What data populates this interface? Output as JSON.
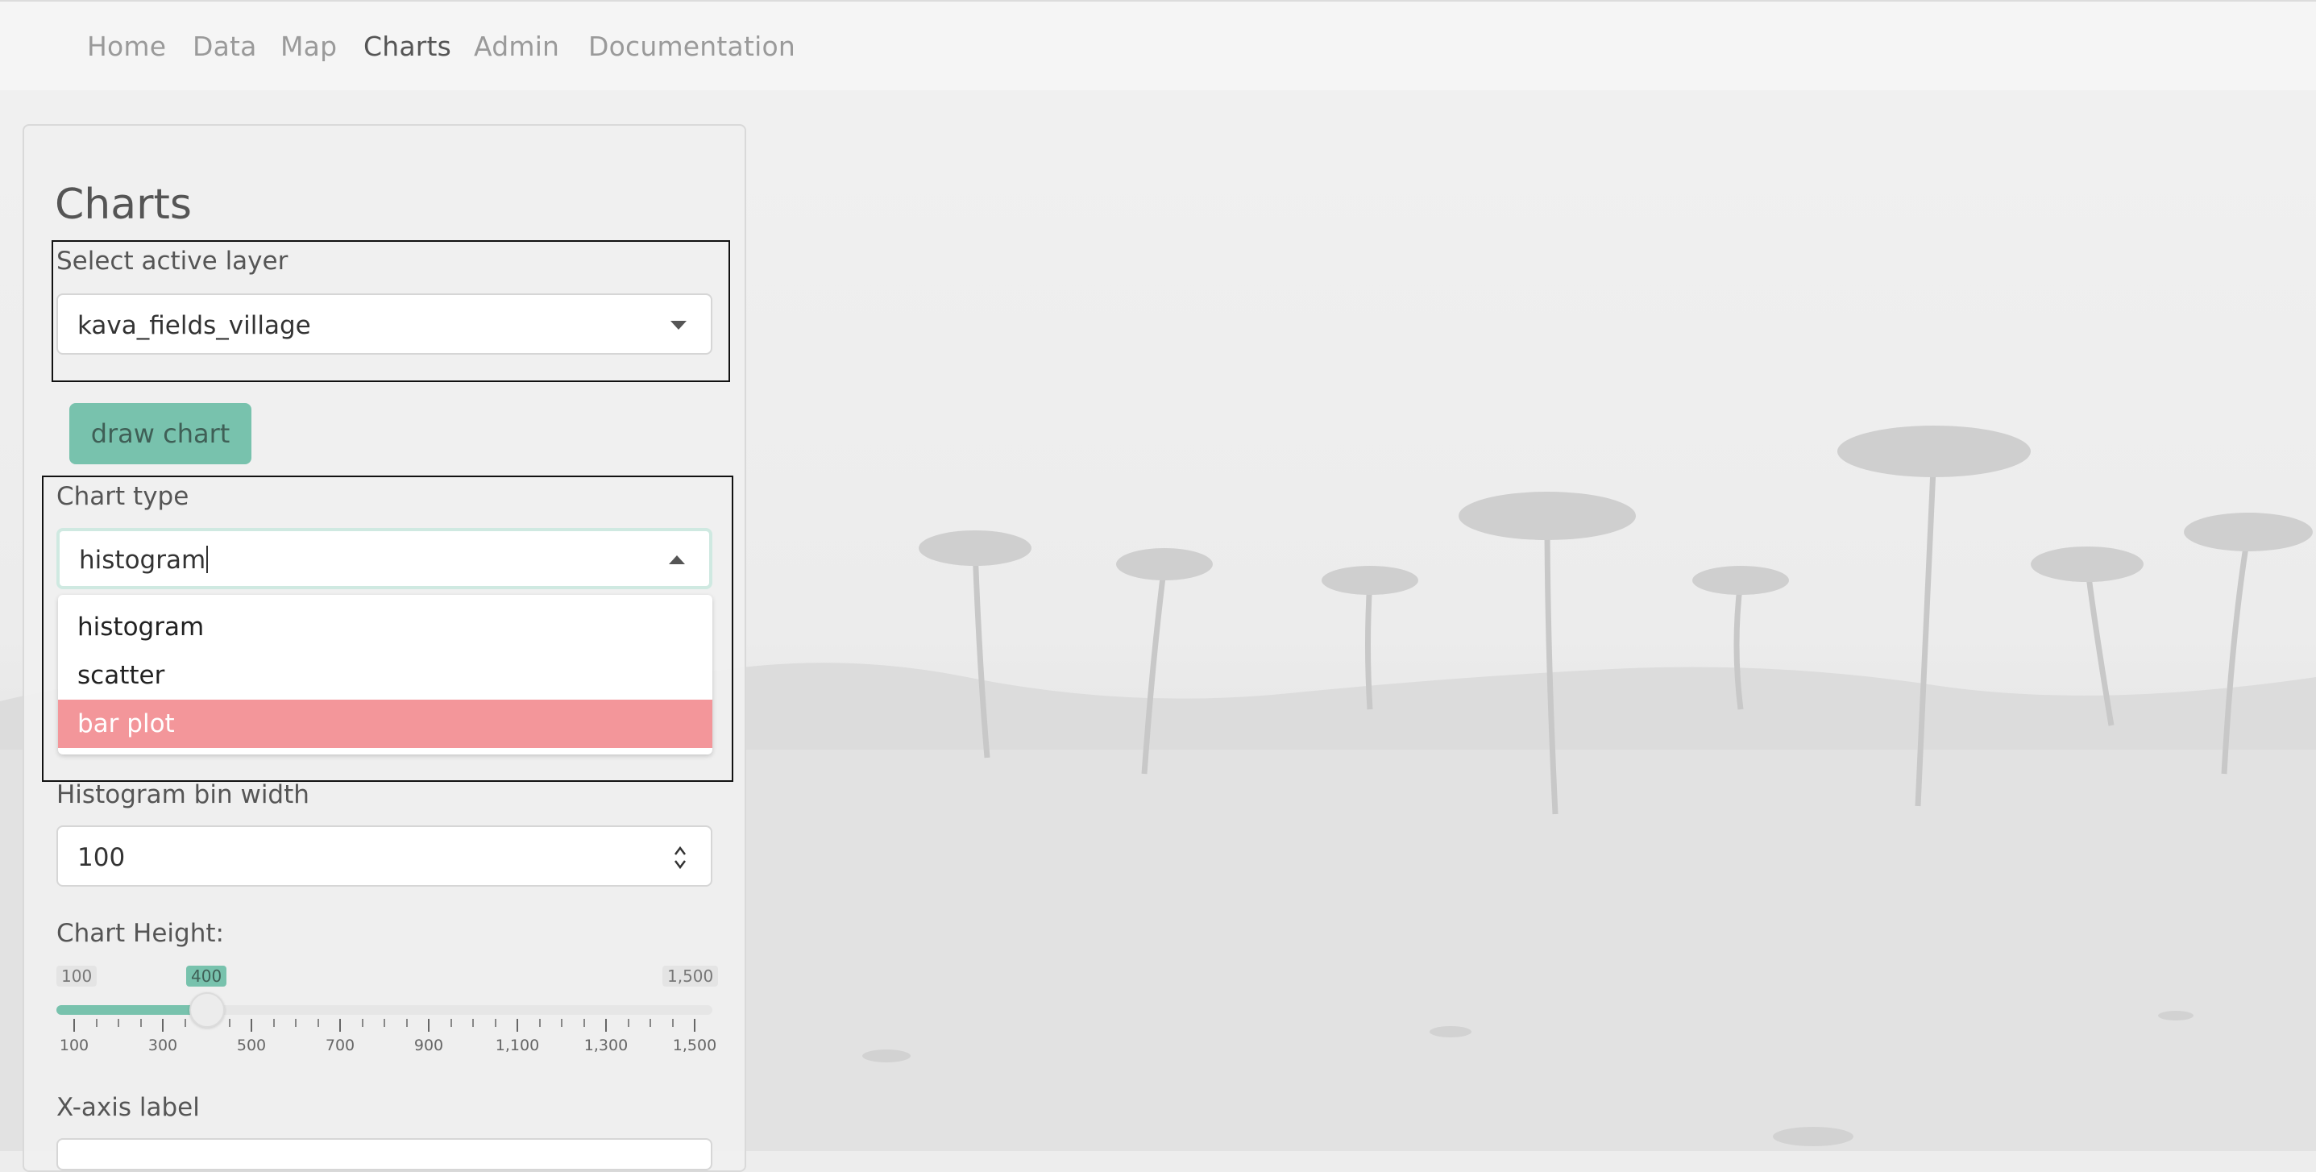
{
  "nav": {
    "items": [
      {
        "label": "Home",
        "active": false
      },
      {
        "label": "Data",
        "active": false
      },
      {
        "label": "Map",
        "active": false
      },
      {
        "label": "Charts",
        "active": true
      },
      {
        "label": "Admin",
        "active": false
      },
      {
        "label": "Documentation",
        "active": false
      }
    ]
  },
  "panel": {
    "title": "Charts",
    "layer": {
      "label": "Select active layer",
      "value": "kava_fields_village"
    },
    "draw_button": "draw chart",
    "chart_type": {
      "label": "Chart type",
      "value": "histogram",
      "options": [
        "histogram",
        "scatter",
        "bar plot"
      ],
      "highlighted": "bar plot"
    },
    "bin_width": {
      "label": "Histogram bin width",
      "value": "100"
    },
    "chart_height": {
      "label": "Chart Height:",
      "min": "100",
      "max": "1,500",
      "current": "400",
      "min_value": 100,
      "max_value": 1500,
      "current_value": 400,
      "ticks": [
        "100",
        "300",
        "500",
        "700",
        "900",
        "1,100",
        "1,300",
        "1,500"
      ]
    },
    "xaxis": {
      "label": "X-axis label",
      "value": ""
    }
  },
  "colors": {
    "accent": "#78c2ad",
    "highlight": "#f3969a",
    "nav_active": "#555555",
    "nav_inactive": "#9a9a9a"
  }
}
